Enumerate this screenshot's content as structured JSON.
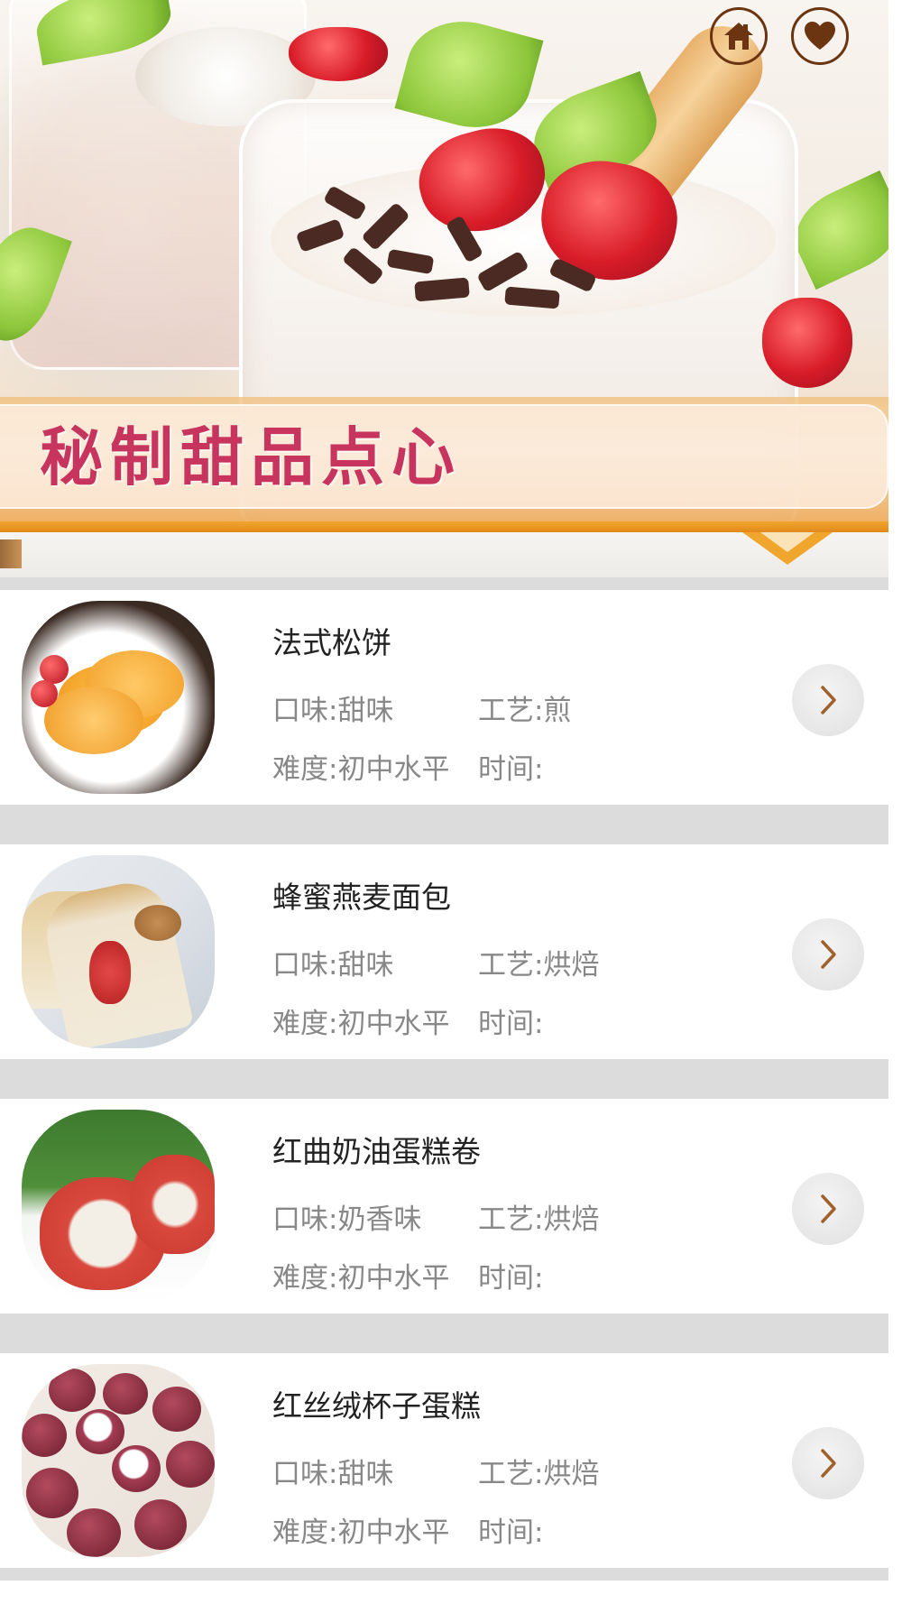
{
  "header": {
    "title": "秘制甜品点心",
    "home_icon": "home-icon",
    "favorite_icon": "heart-icon",
    "icon_color": "#6b3511",
    "title_color": "#c7345e"
  },
  "recipes": [
    {
      "name": "法式松饼",
      "flavor": "口味:甜味",
      "craft": "工艺:煎",
      "level": "难度:初中水平",
      "time": "时间:",
      "image": "pancakes-photo"
    },
    {
      "name": "蜂蜜燕麦面包",
      "flavor": "口味:甜味",
      "craft": "工艺:烘焙",
      "level": "难度:初中水平",
      "time": "时间:",
      "image": "oat-bread-photo"
    },
    {
      "name": "红曲奶油蛋糕卷",
      "flavor": "口味:奶香味",
      "craft": "工艺:烘焙",
      "level": "难度:初中水平",
      "time": "时间:",
      "image": "cake-roll-photo"
    },
    {
      "name": "红丝绒杯子蛋糕",
      "flavor": "口味:甜味",
      "craft": "工艺:烘焙",
      "level": "难度:初中水平",
      "time": "时间:",
      "image": "red-velvet-cupcakes-photo"
    }
  ],
  "colors": {
    "separator": "#dcdcdc",
    "meta_text": "#888888",
    "arrow": "#a0622d",
    "accent_orange": "#f0a62c"
  }
}
